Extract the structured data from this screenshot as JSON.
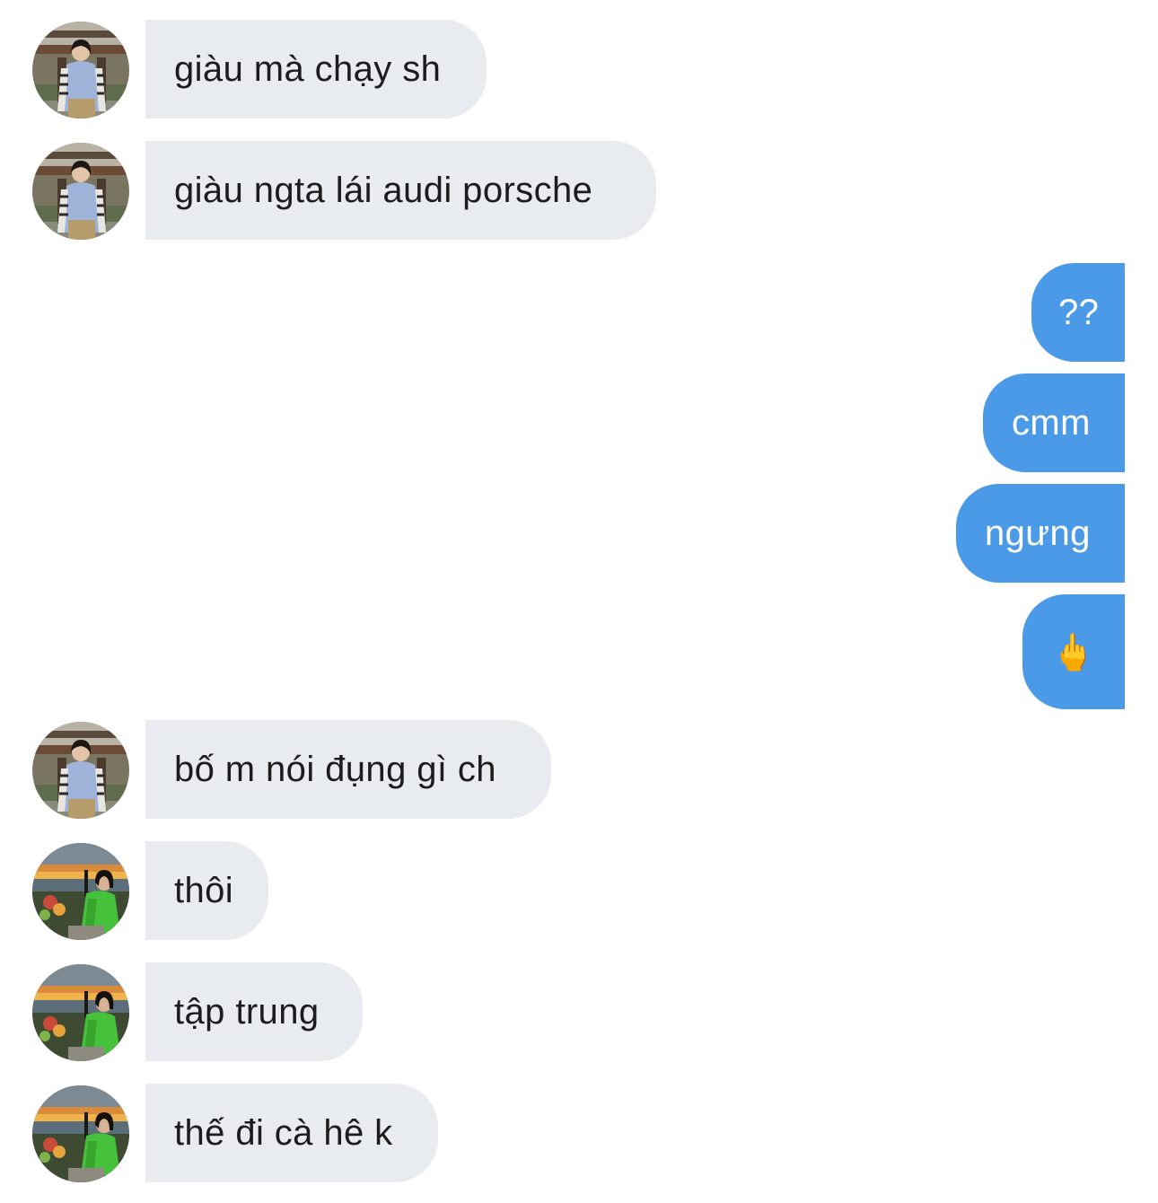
{
  "conversation": {
    "messages": [
      {
        "side": "in",
        "avatar": "girl-striped-avatar",
        "text": "giàu mà chạy sh"
      },
      {
        "side": "in",
        "avatar": "girl-striped-avatar",
        "text": "giàu ngta lái audi porsche"
      },
      {
        "side": "out",
        "text": "??"
      },
      {
        "side": "out",
        "text": "cmm"
      },
      {
        "side": "out",
        "text": "ngưng"
      },
      {
        "side": "out",
        "text": "🖕"
      },
      {
        "side": "in",
        "avatar": "girl-striped-avatar",
        "text": "bố m nói đụng gì ch"
      },
      {
        "side": "in",
        "avatar": "girl-green-sunset-avatar",
        "text": "thôi"
      },
      {
        "side": "in",
        "avatar": "girl-green-sunset-avatar",
        "text": "tập trung"
      },
      {
        "side": "in",
        "avatar": "girl-green-sunset-avatar",
        "text": "thế đi cà hê k"
      }
    ]
  },
  "colors": {
    "incoming_bubble": "#e8ebf0",
    "incoming_text": "#1c1c1e",
    "outgoing_bubble": "#4a9ae8",
    "outgoing_text": "#ffffff"
  }
}
